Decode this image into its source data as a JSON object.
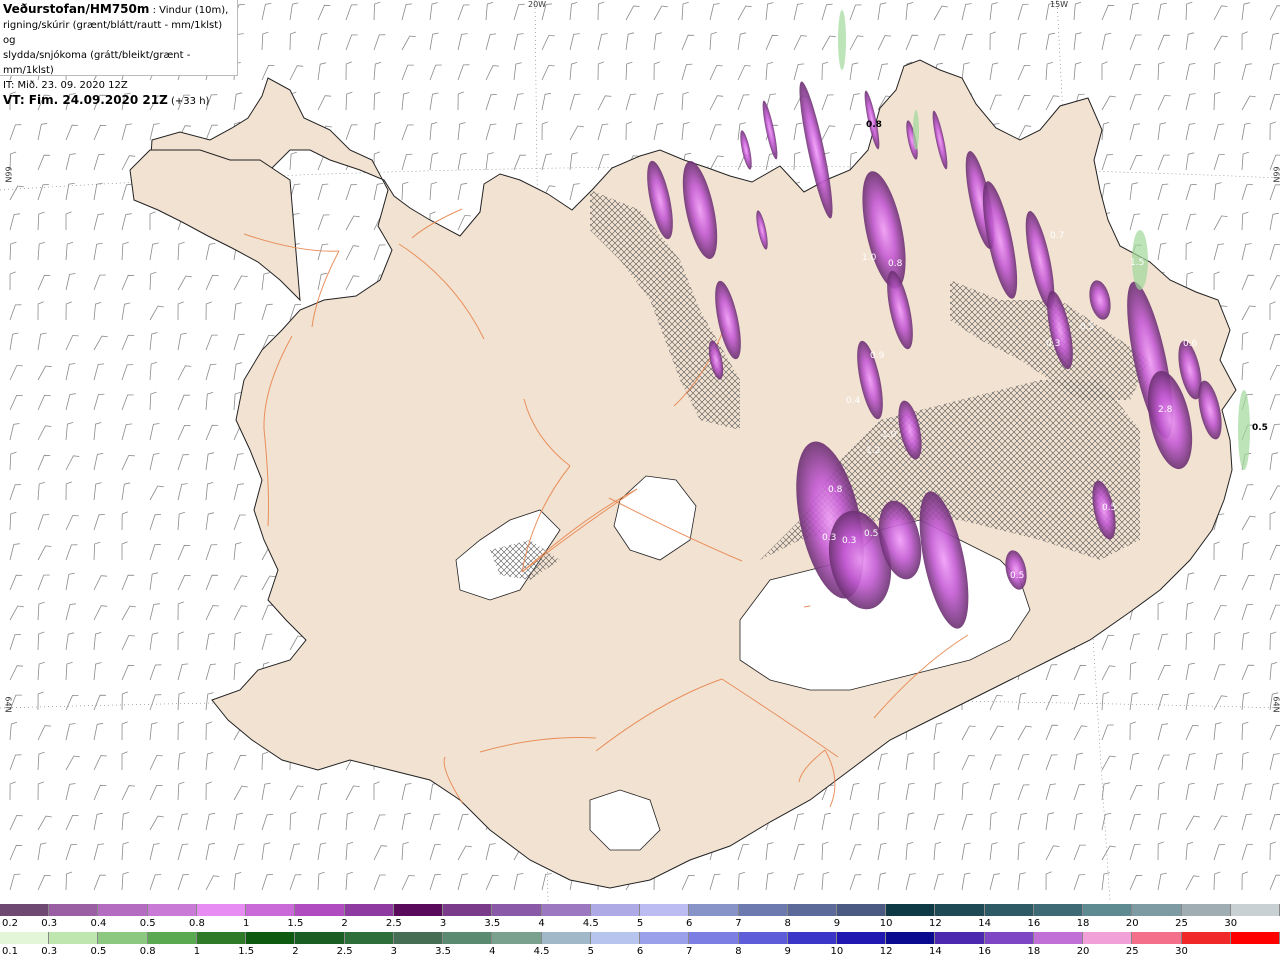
{
  "header": {
    "title": "Veðurstofan/HM750m",
    "desc1": " : Vindur (10m),",
    "desc2": "rigning/skúrir (grænt/blátt/rautt - mm/1klst) og",
    "desc3": "slydda/snjókoma (grátt/bleikt/grænt - mm/1klst)",
    "it_line": "IT: Mið. 23. 09. 2020 12Z",
    "vt_bold": "VT: Fim. 24.09.2020 21Z",
    "vt_rest": " (+33 h)"
  },
  "grid_labels": {
    "lon1": "20W",
    "lon2": "15W",
    "lat_left1": "66N",
    "lat_left2": "64N",
    "lat_right1": "66N",
    "lat_right2": "64N"
  },
  "map_labels": [
    {
      "text": "0.8"
    },
    {
      "text": "0.5"
    },
    {
      "text": "1.5"
    },
    {
      "text": "2.8"
    },
    {
      "text": "1.0"
    },
    {
      "text": "0.8"
    },
    {
      "text": "1.2"
    },
    {
      "text": "0.8"
    },
    {
      "text": "0.5"
    },
    {
      "text": "0.3"
    },
    {
      "text": "0.3"
    },
    {
      "text": "0.9"
    },
    {
      "text": "0.4"
    },
    {
      "text": "1.0"
    },
    {
      "text": "0.5"
    },
    {
      "text": "0.5"
    },
    {
      "text": "0.7"
    },
    {
      "text": "0.6"
    },
    {
      "text": "0.5"
    },
    {
      "text": "0.3"
    }
  ],
  "colors": {
    "land": "#f2e2d2",
    "sea": "#ffffff",
    "roads": "#e8864f",
    "glacier": "#ffffff",
    "precip_dark": "#7a3c78",
    "precip_mid": "#b04cc0",
    "precip_light": "#ea7cf0"
  },
  "legend_snow": {
    "labels": [
      "0.2",
      "0.3",
      "0.4",
      "0.5",
      "0.8",
      "1",
      "1.5",
      "2",
      "2.5",
      "3",
      "3.5",
      "4",
      "4.5",
      "5",
      "6",
      "7",
      "8",
      "9",
      "10",
      "12",
      "14",
      "16",
      "18",
      "20",
      "25",
      "30"
    ],
    "colors": [
      "#6e4a72",
      "#9a5fa2",
      "#b46cc0",
      "#c97ad6",
      "#e68cf2",
      "#ca6ad8",
      "#b04cc0",
      "#8e3aa0",
      "#5a0a5a",
      "#7a3c8a",
      "#8a5aa8",
      "#9c78c0",
      "#aeaae6",
      "#bcbcf2",
      "#8894c8",
      "#6c7ab0",
      "#5c6a9a",
      "#4a5a82",
      "#0e3a46",
      "#1e4a56",
      "#2e5a66",
      "#3e6a76",
      "#5e8a92",
      "#7e9aa2",
      "#a0aeb4",
      "#c8d0d4"
    ]
  },
  "legend_rain": {
    "labels": [
      "0.1",
      "0.3",
      "0.5",
      "0.8",
      "1",
      "1.5",
      "2",
      "2.5",
      "3",
      "3.5",
      "4",
      "4.5",
      "5",
      "6",
      "7",
      "8",
      "9",
      "10",
      "12",
      "14",
      "16",
      "18",
      "20",
      "25",
      "30"
    ],
    "colors": [
      "#e4f6d8",
      "#c0e6b0",
      "#8cc880",
      "#5aa850",
      "#2e7a28",
      "#0e5a10",
      "#1a5e24",
      "#2e6e3a",
      "#466e54",
      "#5a8a70",
      "#7aa08e",
      "#a0b8c8",
      "#b6c4ee",
      "#9aa0ea",
      "#7c7ee4",
      "#5e5cd8",
      "#3c36c8",
      "#2018b0",
      "#0a0a90",
      "#4c28b0",
      "#7e46c4",
      "#c070d6",
      "#f2a0d8",
      "#f4708a",
      "#f02828",
      "#ff0000"
    ]
  }
}
